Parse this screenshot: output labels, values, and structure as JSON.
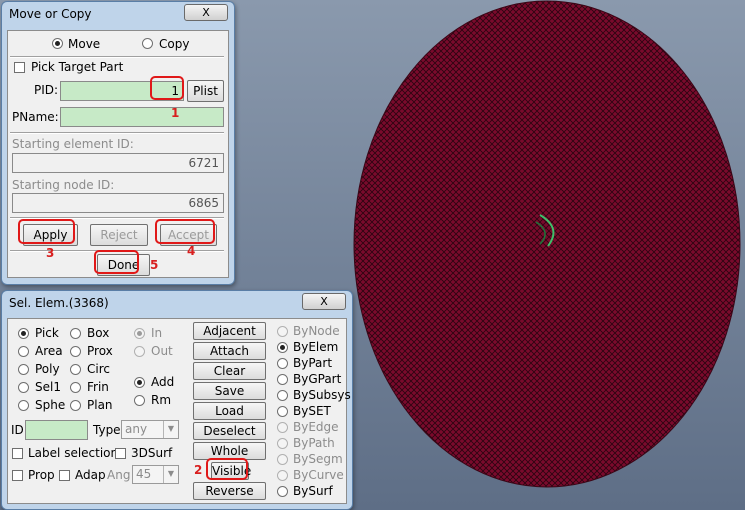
{
  "viewport": {
    "background_top": "#8a99ad",
    "background_bottom": "#5e6e86",
    "mesh_color": "#7a0a2c"
  },
  "move_copy": {
    "title": "Move or Copy",
    "close_label": "X",
    "mode_options": [
      "Move",
      "Copy"
    ],
    "mode_selected": "Move",
    "pick_target_label": "Pick Target Part",
    "pid_label": "PID:",
    "pid_value": "1",
    "plist_label": "Plist",
    "pname_label": "PName:",
    "pname_value": "",
    "start_elem_label": "Starting element ID:",
    "start_elem_value": "6721",
    "start_node_label": "Starting node ID:",
    "start_node_value": "6865",
    "apply_label": "Apply",
    "reject_label": "Reject",
    "accept_label": "Accept",
    "done_label": "Done"
  },
  "sel_elem": {
    "title": "Sel. Elem.(3368)",
    "close_label": "X",
    "methods": [
      "Pick",
      "Box",
      "Area",
      "Prox",
      "Poly",
      "Circ",
      "Sel1",
      "Frin",
      "Sphe",
      "Plan"
    ],
    "method_selected": "Pick",
    "in_label": "In",
    "out_label": "Out",
    "add_label": "Add",
    "rm_label": "Rm",
    "id_label": "ID",
    "type_label": "Type",
    "type_value": "any",
    "label_selection_label": "Label selection",
    "surf3d_label": "3DSurf",
    "prop_label": "Prop",
    "adap_label": "Adap",
    "ang_label": "Ang",
    "ang_value": "45",
    "actions": [
      "Adjacent",
      "Attach",
      "Clear",
      "Save",
      "Load",
      "Deselect",
      "Whole",
      "Visible",
      "Reverse"
    ],
    "by_options": [
      "ByNode",
      "ByElem",
      "ByPart",
      "ByGPart",
      "BySubsys",
      "BySET",
      "ByEdge",
      "ByPath",
      "BySegm",
      "ByCurve",
      "BySurf"
    ],
    "by_selected": "ByElem"
  },
  "annotations": {
    "a1": "1",
    "a2": "2",
    "a3": "3",
    "a4": "4",
    "a5": "5"
  }
}
